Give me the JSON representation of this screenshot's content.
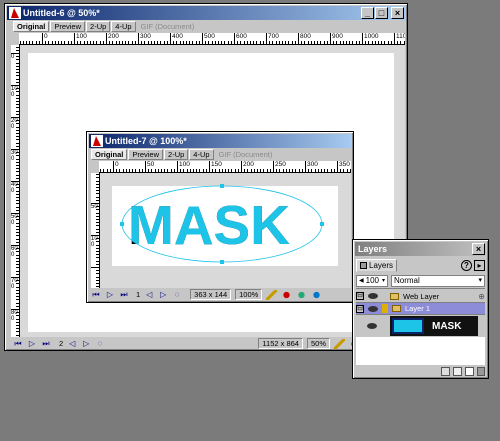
{
  "doc6": {
    "title": "Untitled-6 @ 50%*",
    "tabs": [
      "Original",
      "Preview",
      "2-Up",
      "4-Up"
    ],
    "tab_disabled": "GIF (Document)",
    "ruler_h": [
      "0",
      "100",
      "200",
      "300",
      "400",
      "500",
      "600",
      "700",
      "800",
      "900",
      "1000",
      "1100"
    ],
    "ruler_v": [
      "0",
      "100",
      "200",
      "300",
      "400",
      "500",
      "600",
      "700",
      "800",
      "900"
    ],
    "frame": "2",
    "size": "1152 x 864",
    "zoom": "50%"
  },
  "doc7": {
    "title": "Untitled-7 @ 100%*",
    "tabs": [
      "Original",
      "Preview",
      "2-Up",
      "4-Up"
    ],
    "tab_disabled": "GIF (Document)",
    "ruler_h": [
      "0",
      "50",
      "100",
      "150",
      "200",
      "250",
      "300",
      "350"
    ],
    "ruler_v": [
      "50",
      "100"
    ],
    "frame": "1",
    "size": "363 x 144",
    "zoom": "100%",
    "mask_text": "MASK",
    "mask_color": "#1ec3e8"
  },
  "layers": {
    "title": "Layers",
    "tab": "Layers",
    "opacity": "100",
    "blend_mode": "Normal",
    "web_layer": "Web Layer",
    "layer1": "Layer 1",
    "thumb_text": "MASK"
  }
}
